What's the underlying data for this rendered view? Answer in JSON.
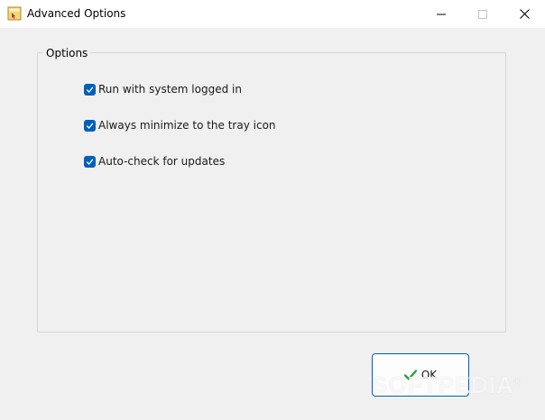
{
  "window": {
    "title": "Advanced Options",
    "app_icon": "app-icon",
    "controls": {
      "minimize_icon": "minimize-icon",
      "maximize_icon": "maximize-icon",
      "close_icon": "close-icon"
    }
  },
  "group": {
    "legend": "Options",
    "options": [
      {
        "label": "Run with system logged in",
        "checked": true
      },
      {
        "label": "Always minimize to the tray icon",
        "checked": true
      },
      {
        "label": "Auto-check for updates",
        "checked": true
      }
    ]
  },
  "ok_button": {
    "label": "OK",
    "icon": "checkmark-icon",
    "icon_color": "#2e9e3e"
  },
  "watermark": "SOFTPEDIA",
  "colors": {
    "accent": "#005fb8",
    "window_bg": "#f0f0f0",
    "titlebar_bg": "#ffffff"
  }
}
